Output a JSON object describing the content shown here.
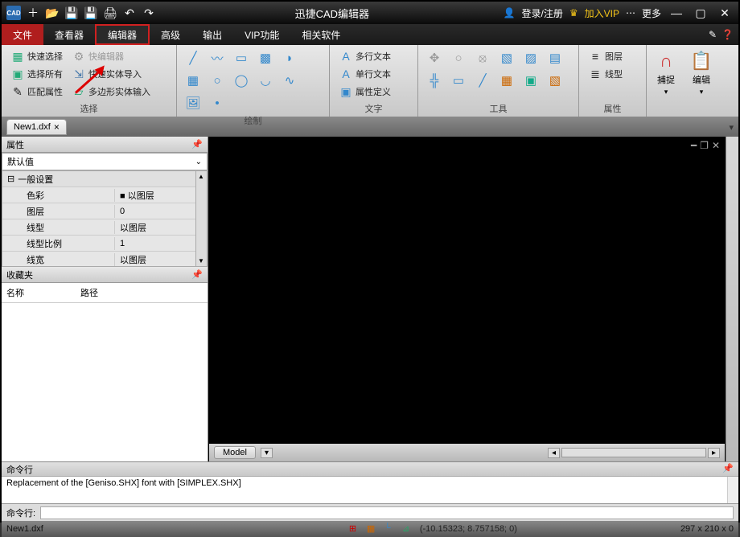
{
  "app_title": "迅捷CAD编辑器",
  "titlebar": {
    "cad": "CAD",
    "login": "登录/注册",
    "vip": "加入VIP",
    "more": "更多"
  },
  "menus": [
    "文件",
    "查看器",
    "编辑器",
    "高级",
    "输出",
    "VIP功能",
    "相关软件"
  ],
  "ribbon": {
    "group_select": {
      "label": "选择",
      "btns": [
        "快速选择",
        "选择所有",
        "匹配属性",
        "快编辑器",
        "快速实体导入",
        "多边形实体输入"
      ]
    },
    "group_draw": {
      "label": "绘制"
    },
    "group_text": {
      "label": "文字",
      "btns": [
        "多行文本",
        "单行文本",
        "属性定义"
      ]
    },
    "group_tools": {
      "label": "工具"
    },
    "group_props": {
      "label": "属性",
      "layer": "图层",
      "linetype": "线型"
    },
    "capture": "捕捉",
    "edit": "编辑"
  },
  "doc_tab": "New1.dxf",
  "props_panel": {
    "title": "属性",
    "default": "默认值",
    "section": "一般设置",
    "rows": [
      {
        "k": "色彩",
        "v": "■ 以图层"
      },
      {
        "k": "图层",
        "v": "0"
      },
      {
        "k": "线型",
        "v": "以图层"
      },
      {
        "k": "线型比例",
        "v": "1"
      },
      {
        "k": "线宽",
        "v": "以图层"
      }
    ]
  },
  "fav_panel": {
    "title": "收藏夹",
    "col_name": "名称",
    "col_path": "路径"
  },
  "model_tab": "Model",
  "cmd": {
    "title": "命令行",
    "log": "Replacement of the [Geniso.SHX] font with [SIMPLEX.SHX]",
    "prompt": "命令行:"
  },
  "status": {
    "file": "New1.dxf",
    "coords": "(-10.15323; 8.757158; 0)",
    "dims": "297 x 210 x 0"
  }
}
